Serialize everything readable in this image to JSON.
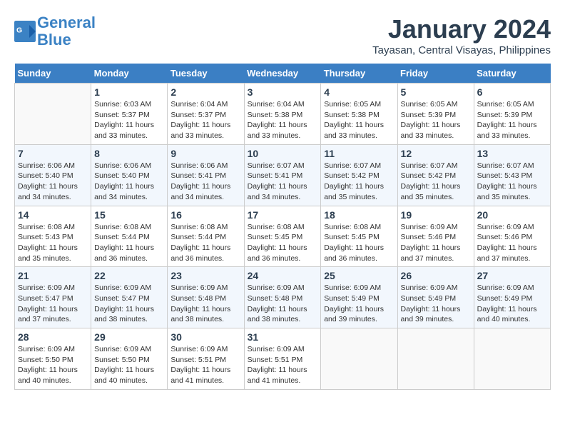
{
  "logo": {
    "line1": "General",
    "line2": "Blue"
  },
  "title": "January 2024",
  "location": "Tayasan, Central Visayas, Philippines",
  "days_header": [
    "Sunday",
    "Monday",
    "Tuesday",
    "Wednesday",
    "Thursday",
    "Friday",
    "Saturday"
  ],
  "weeks": [
    [
      {
        "day": "",
        "sunrise": "",
        "sunset": "",
        "daylight": ""
      },
      {
        "day": "1",
        "sunrise": "Sunrise: 6:03 AM",
        "sunset": "Sunset: 5:37 PM",
        "daylight": "Daylight: 11 hours and 33 minutes."
      },
      {
        "day": "2",
        "sunrise": "Sunrise: 6:04 AM",
        "sunset": "Sunset: 5:37 PM",
        "daylight": "Daylight: 11 hours and 33 minutes."
      },
      {
        "day": "3",
        "sunrise": "Sunrise: 6:04 AM",
        "sunset": "Sunset: 5:38 PM",
        "daylight": "Daylight: 11 hours and 33 minutes."
      },
      {
        "day": "4",
        "sunrise": "Sunrise: 6:05 AM",
        "sunset": "Sunset: 5:38 PM",
        "daylight": "Daylight: 11 hours and 33 minutes."
      },
      {
        "day": "5",
        "sunrise": "Sunrise: 6:05 AM",
        "sunset": "Sunset: 5:39 PM",
        "daylight": "Daylight: 11 hours and 33 minutes."
      },
      {
        "day": "6",
        "sunrise": "Sunrise: 6:05 AM",
        "sunset": "Sunset: 5:39 PM",
        "daylight": "Daylight: 11 hours and 33 minutes."
      }
    ],
    [
      {
        "day": "7",
        "sunrise": "Sunrise: 6:06 AM",
        "sunset": "Sunset: 5:40 PM",
        "daylight": "Daylight: 11 hours and 34 minutes."
      },
      {
        "day": "8",
        "sunrise": "Sunrise: 6:06 AM",
        "sunset": "Sunset: 5:40 PM",
        "daylight": "Daylight: 11 hours and 34 minutes."
      },
      {
        "day": "9",
        "sunrise": "Sunrise: 6:06 AM",
        "sunset": "Sunset: 5:41 PM",
        "daylight": "Daylight: 11 hours and 34 minutes."
      },
      {
        "day": "10",
        "sunrise": "Sunrise: 6:07 AM",
        "sunset": "Sunset: 5:41 PM",
        "daylight": "Daylight: 11 hours and 34 minutes."
      },
      {
        "day": "11",
        "sunrise": "Sunrise: 6:07 AM",
        "sunset": "Sunset: 5:42 PM",
        "daylight": "Daylight: 11 hours and 35 minutes."
      },
      {
        "day": "12",
        "sunrise": "Sunrise: 6:07 AM",
        "sunset": "Sunset: 5:42 PM",
        "daylight": "Daylight: 11 hours and 35 minutes."
      },
      {
        "day": "13",
        "sunrise": "Sunrise: 6:07 AM",
        "sunset": "Sunset: 5:43 PM",
        "daylight": "Daylight: 11 hours and 35 minutes."
      }
    ],
    [
      {
        "day": "14",
        "sunrise": "Sunrise: 6:08 AM",
        "sunset": "Sunset: 5:43 PM",
        "daylight": "Daylight: 11 hours and 35 minutes."
      },
      {
        "day": "15",
        "sunrise": "Sunrise: 6:08 AM",
        "sunset": "Sunset: 5:44 PM",
        "daylight": "Daylight: 11 hours and 36 minutes."
      },
      {
        "day": "16",
        "sunrise": "Sunrise: 6:08 AM",
        "sunset": "Sunset: 5:44 PM",
        "daylight": "Daylight: 11 hours and 36 minutes."
      },
      {
        "day": "17",
        "sunrise": "Sunrise: 6:08 AM",
        "sunset": "Sunset: 5:45 PM",
        "daylight": "Daylight: 11 hours and 36 minutes."
      },
      {
        "day": "18",
        "sunrise": "Sunrise: 6:08 AM",
        "sunset": "Sunset: 5:45 PM",
        "daylight": "Daylight: 11 hours and 36 minutes."
      },
      {
        "day": "19",
        "sunrise": "Sunrise: 6:09 AM",
        "sunset": "Sunset: 5:46 PM",
        "daylight": "Daylight: 11 hours and 37 minutes."
      },
      {
        "day": "20",
        "sunrise": "Sunrise: 6:09 AM",
        "sunset": "Sunset: 5:46 PM",
        "daylight": "Daylight: 11 hours and 37 minutes."
      }
    ],
    [
      {
        "day": "21",
        "sunrise": "Sunrise: 6:09 AM",
        "sunset": "Sunset: 5:47 PM",
        "daylight": "Daylight: 11 hours and 37 minutes."
      },
      {
        "day": "22",
        "sunrise": "Sunrise: 6:09 AM",
        "sunset": "Sunset: 5:47 PM",
        "daylight": "Daylight: 11 hours and 38 minutes."
      },
      {
        "day": "23",
        "sunrise": "Sunrise: 6:09 AM",
        "sunset": "Sunset: 5:48 PM",
        "daylight": "Daylight: 11 hours and 38 minutes."
      },
      {
        "day": "24",
        "sunrise": "Sunrise: 6:09 AM",
        "sunset": "Sunset: 5:48 PM",
        "daylight": "Daylight: 11 hours and 38 minutes."
      },
      {
        "day": "25",
        "sunrise": "Sunrise: 6:09 AM",
        "sunset": "Sunset: 5:49 PM",
        "daylight": "Daylight: 11 hours and 39 minutes."
      },
      {
        "day": "26",
        "sunrise": "Sunrise: 6:09 AM",
        "sunset": "Sunset: 5:49 PM",
        "daylight": "Daylight: 11 hours and 39 minutes."
      },
      {
        "day": "27",
        "sunrise": "Sunrise: 6:09 AM",
        "sunset": "Sunset: 5:49 PM",
        "daylight": "Daylight: 11 hours and 40 minutes."
      }
    ],
    [
      {
        "day": "28",
        "sunrise": "Sunrise: 6:09 AM",
        "sunset": "Sunset: 5:50 PM",
        "daylight": "Daylight: 11 hours and 40 minutes."
      },
      {
        "day": "29",
        "sunrise": "Sunrise: 6:09 AM",
        "sunset": "Sunset: 5:50 PM",
        "daylight": "Daylight: 11 hours and 40 minutes."
      },
      {
        "day": "30",
        "sunrise": "Sunrise: 6:09 AM",
        "sunset": "Sunset: 5:51 PM",
        "daylight": "Daylight: 11 hours and 41 minutes."
      },
      {
        "day": "31",
        "sunrise": "Sunrise: 6:09 AM",
        "sunset": "Sunset: 5:51 PM",
        "daylight": "Daylight: 11 hours and 41 minutes."
      },
      {
        "day": "",
        "sunrise": "",
        "sunset": "",
        "daylight": ""
      },
      {
        "day": "",
        "sunrise": "",
        "sunset": "",
        "daylight": ""
      },
      {
        "day": "",
        "sunrise": "",
        "sunset": "",
        "daylight": ""
      }
    ]
  ]
}
